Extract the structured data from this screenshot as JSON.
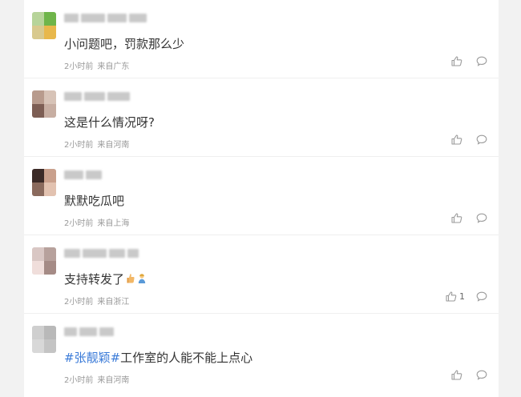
{
  "comments": [
    {
      "text": "小问题吧，罚款那么少",
      "time": "2小时前",
      "location": "来自广东",
      "likes": "",
      "avatar_colors": [
        "#b7d49a",
        "#6fb54a",
        "#d8c98e",
        "#e8b84c"
      ]
    },
    {
      "text": "这是什么情况呀?",
      "time": "2小时前",
      "location": "来自河南",
      "likes": "",
      "avatar_colors": [
        "#b89b8d",
        "#d7c3b7",
        "#7d5e54",
        "#c7aea2"
      ]
    },
    {
      "text": "默默吃瓜吧",
      "time": "2小时前",
      "location": "来自上海",
      "likes": "",
      "avatar_colors": [
        "#3b2a27",
        "#c9a08c",
        "#8a6a5d",
        "#e2c2b0"
      ]
    },
    {
      "text": "支持转发了",
      "time": "2小时前",
      "location": "来自浙江",
      "likes": "1",
      "avatar_colors": [
        "#d9c7c4",
        "#b7a19c",
        "#f0dedb",
        "#a58b86"
      ],
      "emojis": [
        "thumb-emoji",
        "person-emoji"
      ]
    },
    {
      "hashtag": "#张靓颖#",
      "text": "工作室的人能不能上点心",
      "time": "2小时前",
      "location": "来自河南",
      "likes": "",
      "avatar_colors": [
        "#cfcfcf",
        "#b9b9b9",
        "#d8d8d8",
        "#c4c4c4"
      ]
    }
  ],
  "colors": {
    "text": "#333333",
    "meta": "#999999",
    "hashtag": "#3b7bd8",
    "icon": "#9a9a9a"
  }
}
